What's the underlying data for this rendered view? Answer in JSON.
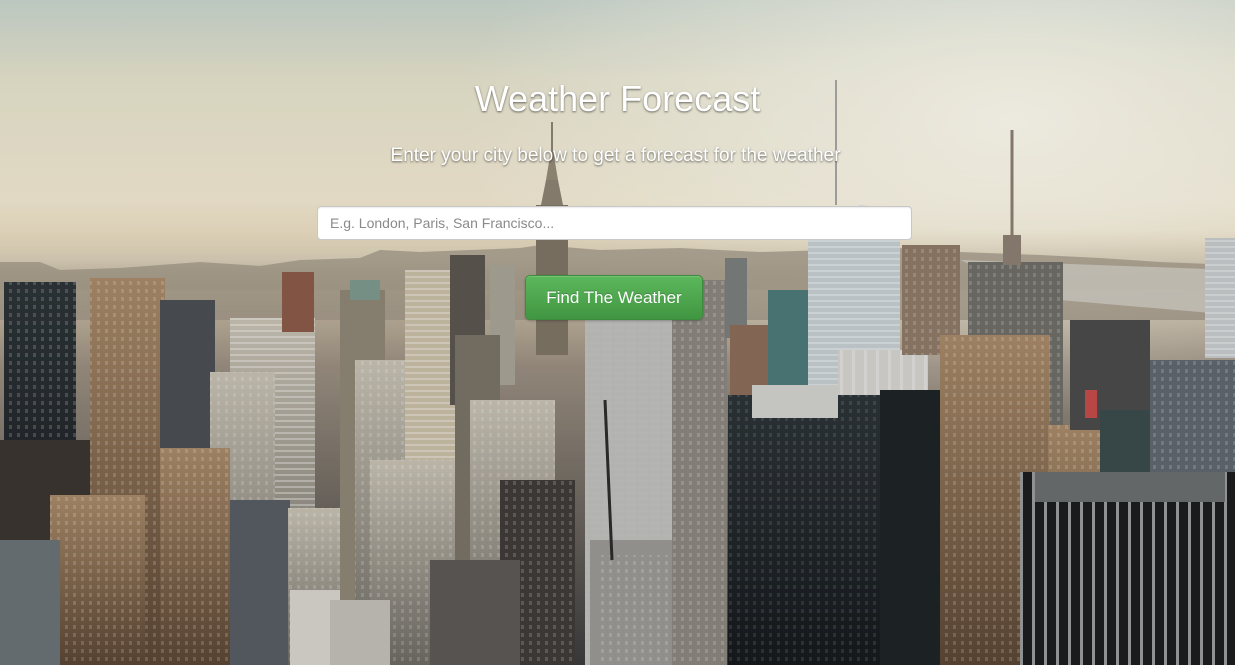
{
  "header": {
    "title": "Weather Forecast",
    "subtitle": "Enter your city below to get a forecast for the weather"
  },
  "search": {
    "placeholder": "E.g. London, Paris, San Francisco...",
    "value": ""
  },
  "actions": {
    "find_label": "Find The Weather"
  },
  "background": {
    "description_icon": "city-skyline-photo",
    "sky_color": "#f4ead2",
    "haze_color": "#e9dcc0",
    "building_dark": "#1c2228",
    "building_warm": "#8a6a4a"
  },
  "colors": {
    "button_green": "#5cb85c",
    "text": "#ffffff"
  }
}
